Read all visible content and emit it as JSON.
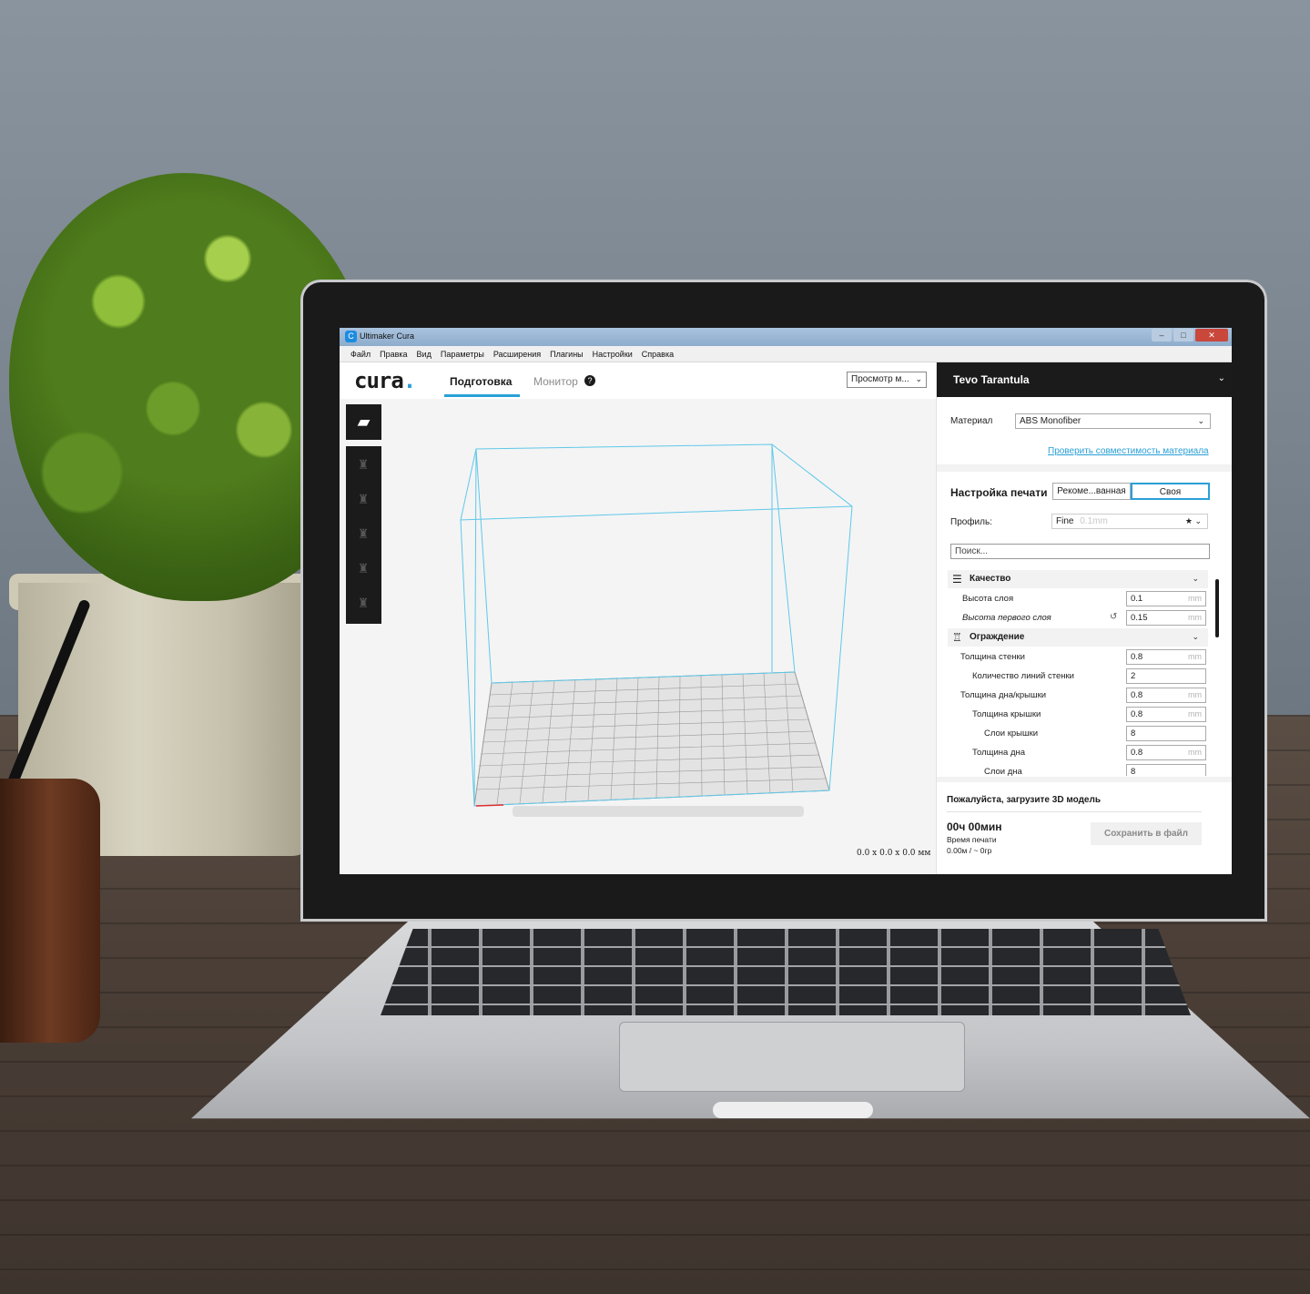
{
  "window": {
    "title": "Ultimaker Cura",
    "app_icon": "C",
    "buttons": {
      "minimize": "–",
      "maximize": "□",
      "close": "✕"
    }
  },
  "menubar": {
    "items": [
      "Файл",
      "Правка",
      "Вид",
      "Параметры",
      "Расширения",
      "Плагины",
      "Настройки",
      "Справка"
    ]
  },
  "header": {
    "logo": "cura",
    "logo_dot": ".",
    "tabs": [
      "Подготовка",
      "Монитор"
    ],
    "help_icon": "?",
    "view_select": "Просмотр м...",
    "accent_color": "#2aa0d6"
  },
  "viewport": {
    "dimensions": "0.0 x 0.0 x 0.0 мм",
    "build_volume_color": "#5fc8e8"
  },
  "sidebar": {
    "printer_name": "Tevo Tarantula",
    "material_label": "Материал",
    "material_value": "ABS Monofiber",
    "compat_link": "Проверить совместимость материала",
    "print_setup_title": "Настройка печати",
    "mode_recommended": "Рекоме...ванная",
    "mode_custom": "Своя",
    "profile_label": "Профиль:",
    "profile_value": "Fine",
    "profile_hint": "0.1mm",
    "search_placeholder": "Поиск...",
    "categories": [
      {
        "label": "Качество",
        "icon": "quality-icon"
      },
      {
        "label": "Ограждение",
        "icon": "shell-icon"
      }
    ],
    "settings": [
      {
        "label": "Высота слоя",
        "value": "0.1",
        "unit": "mm"
      },
      {
        "label": "Высота первого слоя",
        "value": "0.15",
        "unit": "mm"
      },
      {
        "label": "Толщина стенки",
        "value": "0.8",
        "unit": "mm"
      },
      {
        "label": "Количество линий стенки",
        "value": "2",
        "unit": ""
      },
      {
        "label": "Толщина дна/крышки",
        "value": "0.8",
        "unit": "mm"
      },
      {
        "label": "Толщина крышки",
        "value": "0.8",
        "unit": "mm"
      },
      {
        "label": "Слои крышки",
        "value": "8",
        "unit": ""
      },
      {
        "label": "Толщина дна",
        "value": "0.8",
        "unit": "mm"
      },
      {
        "label": "Слои дна",
        "value": "8",
        "unit": ""
      }
    ],
    "footer": {
      "message": "Пожалуйста, загрузите 3D модель",
      "print_time": "00ч 00мин",
      "print_time_label": "Время печати",
      "print_amount": "0.00м / ~ 0гр",
      "save_button": "Сохранить в файл"
    }
  }
}
